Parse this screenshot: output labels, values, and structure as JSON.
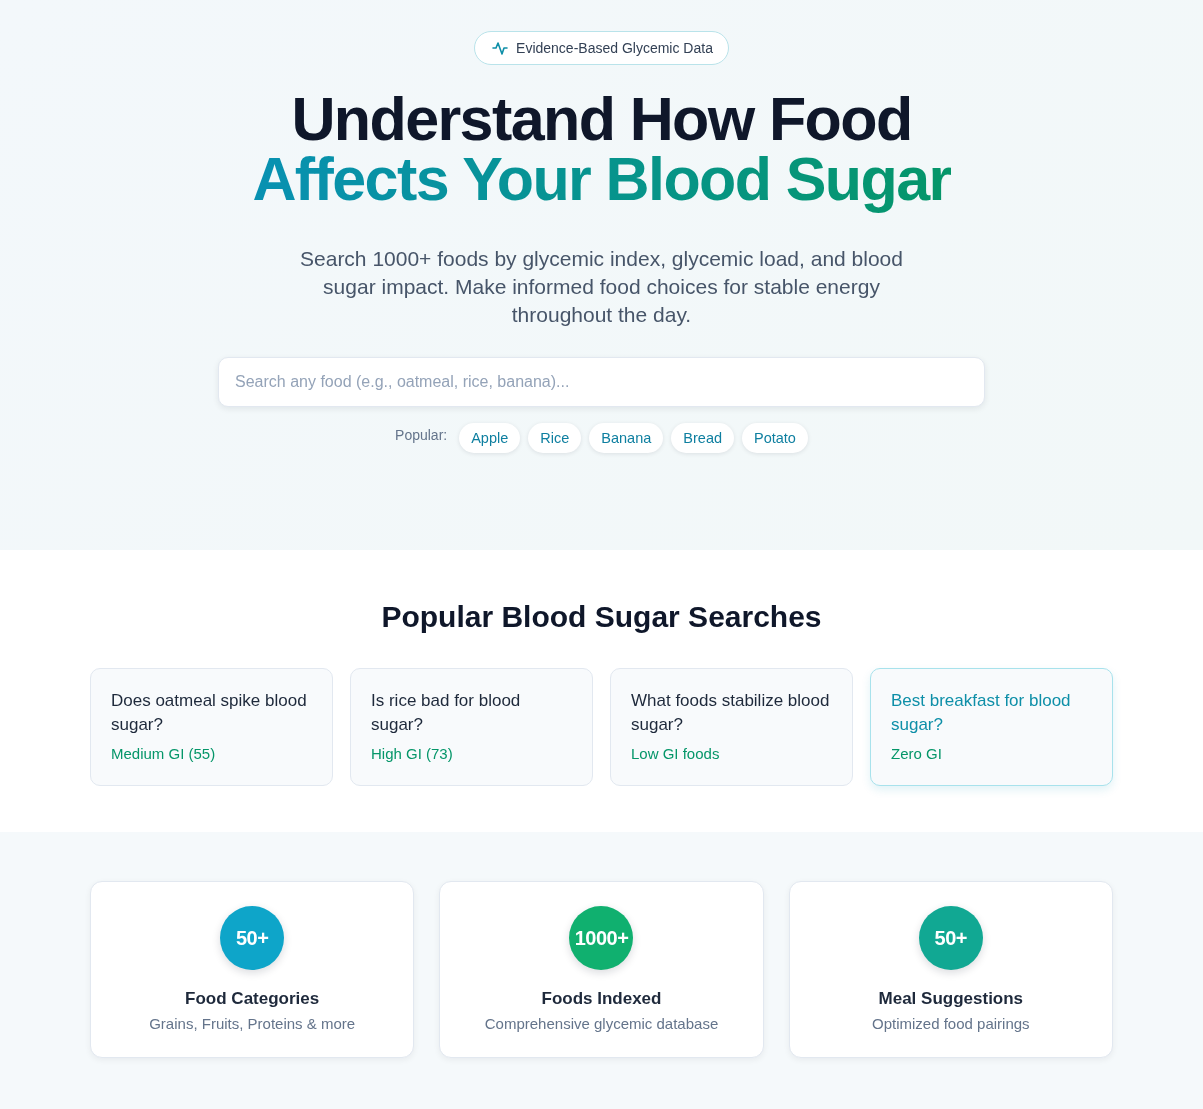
{
  "badge": {
    "text": "Evidence-Based Glycemic Data"
  },
  "hero": {
    "title": "Understand How Food",
    "title_highlight": "Affects Your Blood Sugar",
    "subtitle": "Search 1000+ foods by glycemic index, glycemic load, and blood sugar impact. Make informed food choices for stable energy throughout the day.",
    "search": {
      "placeholder": "Search any food (e.g., oatmeal, rice, banana)..."
    },
    "popular": {
      "label": "Popular:",
      "items": [
        "Apple",
        "Rice",
        "Banana",
        "Bread",
        "Potato"
      ]
    }
  },
  "popular_searches": {
    "title": "Popular Blood Sugar Searches",
    "cards": [
      {
        "question": "Does oatmeal spike blood sugar?",
        "answer": "Medium GI (55)",
        "highlighted": false
      },
      {
        "question": "Is rice bad for blood sugar?",
        "answer": "High GI (73)",
        "highlighted": false
      },
      {
        "question": "What foods stabilize blood sugar?",
        "answer": "Low GI foods",
        "highlighted": false
      },
      {
        "question": "Best breakfast for blood sugar?",
        "answer": "Zero GI",
        "highlighted": true
      }
    ]
  },
  "stats": [
    {
      "value": "50+",
      "color": "#0ea5c9",
      "label": "Food Categories",
      "description": "Grains, Fruits, Proteins & more"
    },
    {
      "value": "1000+",
      "color": "#10b06f",
      "label": "Foods Indexed",
      "description": "Comprehensive glycemic database"
    },
    {
      "value": "50+",
      "color": "#11a893",
      "label": "Meal Suggestions",
      "description": "Optimized food pairings"
    }
  ]
}
